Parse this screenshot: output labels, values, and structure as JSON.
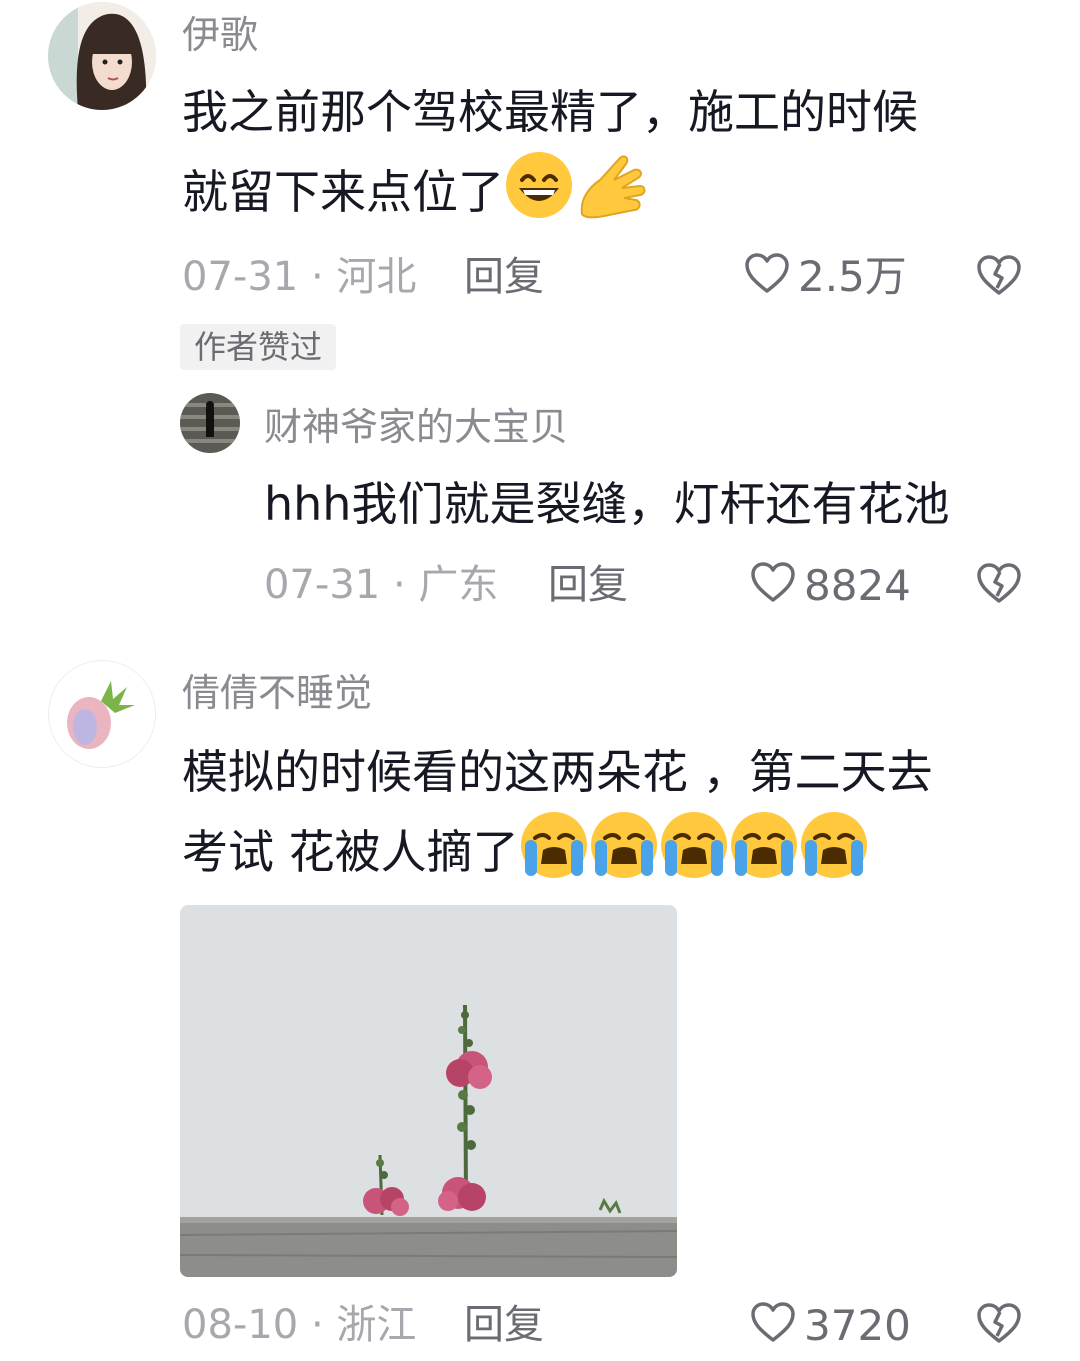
{
  "comments": [
    {
      "username": "伊歌",
      "text_line1": "我之前那个驾校最精了，施工的时候",
      "text_line2": "就留下来点位了",
      "emojis": [
        "grinning-face-emoji",
        "ok-hand-emoji"
      ],
      "date": "07-31",
      "region": "河北",
      "reply_label": "回复",
      "likes": "2.5万",
      "badge": "作者赞过",
      "reply": {
        "username": "财神爷家的大宝贝",
        "text": "hhh我们就是裂缝，灯杆还有花池",
        "date": "07-31",
        "region": "广东",
        "reply_label": "回复",
        "likes": "8824"
      }
    },
    {
      "username": "倩倩不睡觉",
      "text_line1": "模拟的时候看的这两朵花 ，第二天去",
      "text_line2": "考试 花被人摘了",
      "emojis": [
        "loudly-crying-face-emoji",
        "loudly-crying-face-emoji",
        "loudly-crying-face-emoji",
        "loudly-crying-face-emoji",
        "loudly-crying-face-emoji"
      ],
      "date": "08-10",
      "region": "浙江",
      "reply_label": "回复",
      "likes": "3720"
    }
  ],
  "meta_separator": " · ",
  "icons": [
    "heart-outline-icon",
    "broken-heart-icon"
  ],
  "colors": {
    "text": "#161823",
    "username": "#8a8b91",
    "meta": "#a7a8ad",
    "action": "#6b6c73"
  }
}
